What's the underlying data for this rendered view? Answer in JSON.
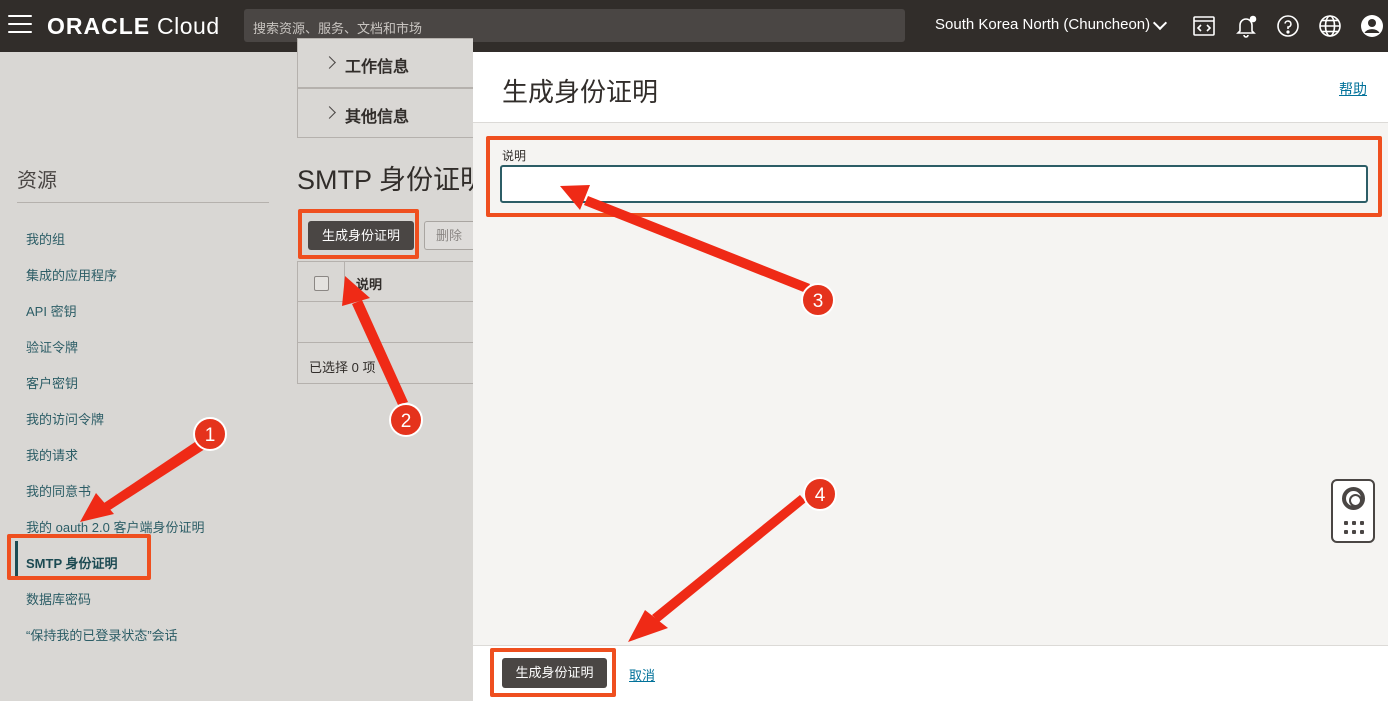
{
  "topbar": {
    "logo_oracle": "ORACLE",
    "logo_cloud": "Cloud",
    "search_placeholder": "搜索资源、服务、文档和市场",
    "region": "South Korea North (Chuncheon)"
  },
  "left": {
    "accordions": [
      "工作信息",
      "其他信息"
    ],
    "resources_title": "资源",
    "resources": [
      "我的组",
      "集成的应用程序",
      "API 密钥",
      "验证令牌",
      "客户密钥",
      "我的访问令牌",
      "我的请求",
      "我的同意书",
      "我的 oauth 2.0 客户端身份证明",
      "SMTP 身份证明",
      "数据库密码",
      "“保持我的已登录状态”会话"
    ],
    "section_title": "SMTP 身份证明",
    "generate_button": "生成身份证明",
    "delete_button": "删除",
    "table_header": "说明",
    "selected_text": "已选择 0 项"
  },
  "drawer": {
    "title": "生成身份证明",
    "help_link": "帮助",
    "description_label": "说明",
    "description_value": "",
    "generate_button": "生成身份证明",
    "cancel_link": "取消"
  },
  "annotations": [
    "1",
    "2",
    "3",
    "4"
  ],
  "colors": {
    "topbar": "#312d2a",
    "accent_link": "#02729a",
    "annotation": "#ef4f1f",
    "button_dark": "#4a4644"
  }
}
